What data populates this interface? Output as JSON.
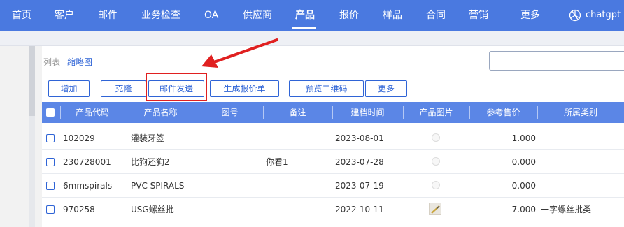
{
  "nav": {
    "items": [
      "首页",
      "客户",
      "邮件",
      "业务检查",
      "OA",
      "供应商",
      "产品",
      "报价",
      "样品",
      "合同",
      "营销",
      "更多"
    ],
    "active": "产品",
    "brand": "chatgpt"
  },
  "view_tabs": {
    "list": "列表",
    "thumbnail": "缩略图"
  },
  "search": {
    "placeholder": ""
  },
  "toolbar": {
    "add": "增加",
    "clone": "克隆",
    "email_send": "邮件发送",
    "generate_quote": "生成报价单",
    "preview_qr": "预览二维码",
    "more": "更多"
  },
  "table": {
    "headers": {
      "code": "产品代码",
      "name": "产品名称",
      "drawing": "图号",
      "note": "备注",
      "created": "建档时间",
      "image": "产品图片",
      "price": "参考售价",
      "category": "所属类别"
    },
    "rows": [
      {
        "code": "102029",
        "name": "灌装牙签",
        "drawing": "",
        "note": "",
        "created": "2023-08-01",
        "image": "placeholder",
        "price": "1.000",
        "category": ""
      },
      {
        "code": "230728001",
        "name": "比狗还狗2",
        "drawing": "",
        "note": "你看1",
        "created": "2023-07-28",
        "image": "placeholder",
        "price": "0.000",
        "category": ""
      },
      {
        "code": "6mmspirals",
        "name": "PVC SPIRALS",
        "drawing": "",
        "note": "",
        "created": "2023-07-19",
        "image": "placeholder",
        "price": "0.000",
        "category": ""
      },
      {
        "code": "970258",
        "name": "USG螺丝批",
        "drawing": "",
        "note": "",
        "created": "2022-10-11",
        "image": "photo",
        "price": "7.000",
        "category": "一字螺丝批类"
      }
    ]
  },
  "colors": {
    "nav_bg": "#4a79e0",
    "header_bg": "#5b86e6",
    "accent": "#2f64d6",
    "annotation_red": "#e02020"
  }
}
